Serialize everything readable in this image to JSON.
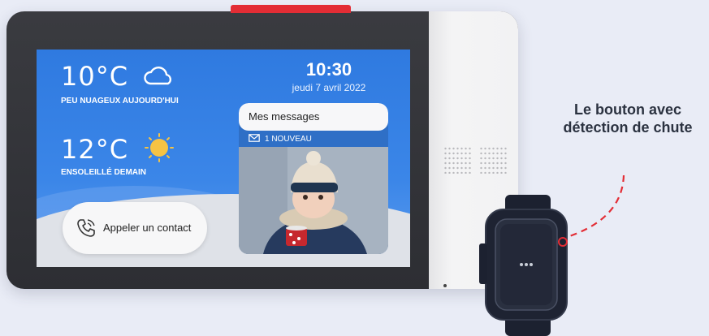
{
  "weather": {
    "today_temp": "10°C",
    "today_label": "PEU NUAGEUX AUJOURD'HUI",
    "today_icon": "cloud-icon",
    "tomorrow_temp": "12°C",
    "tomorrow_label": "ENSOLEILLÉ DEMAIN",
    "tomorrow_icon": "sun-icon"
  },
  "clock": {
    "time": "10:30",
    "date": "jeudi 7 avril 2022"
  },
  "messages": {
    "title": "Mes messages",
    "new_count": "1 NOUVEAU",
    "icon": "envelope-icon"
  },
  "call": {
    "label": "Appeler un contact",
    "icon": "phone-icon"
  },
  "annotation": {
    "text": "Le bouton avec détection de chute"
  },
  "colors": {
    "accent_red": "#e32d35",
    "screen_blue": "#2f7ae0",
    "sun": "#f6c343",
    "callout_line": "#e32d35"
  }
}
